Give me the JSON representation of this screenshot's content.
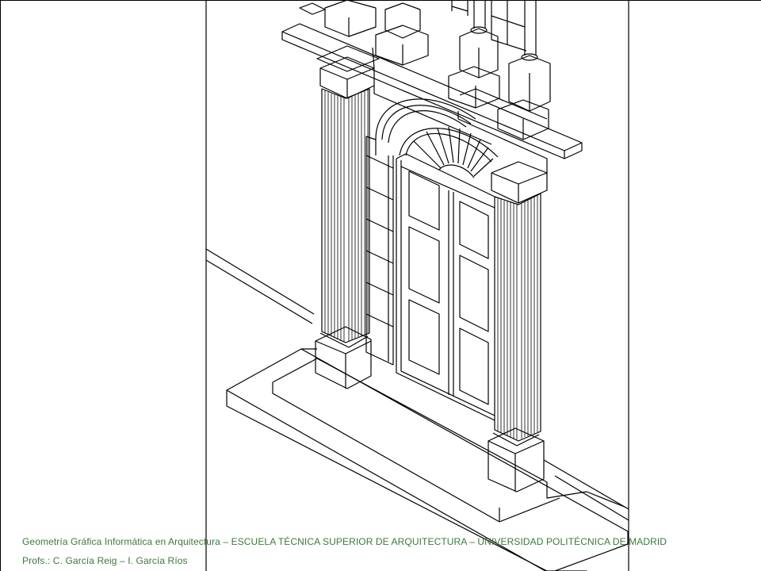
{
  "footer": {
    "line1": "Geometría Gráfica Informática en Arquitectura – ESCUELA TÉCNICA SUPERIOR DE ARQUITECTURA  – UNIVERSIDAD POLITÉCNICA  DE MADRID",
    "line2": "Profs.: C. García Reig – I. García Ríos"
  },
  "colors": {
    "footer_text": "#3a7a3a",
    "line": "#000000",
    "background": "#ffffff"
  },
  "drawing": {
    "subject": "isometric line drawing of classical doorway with fluted pilasters, fanlight and steps"
  }
}
